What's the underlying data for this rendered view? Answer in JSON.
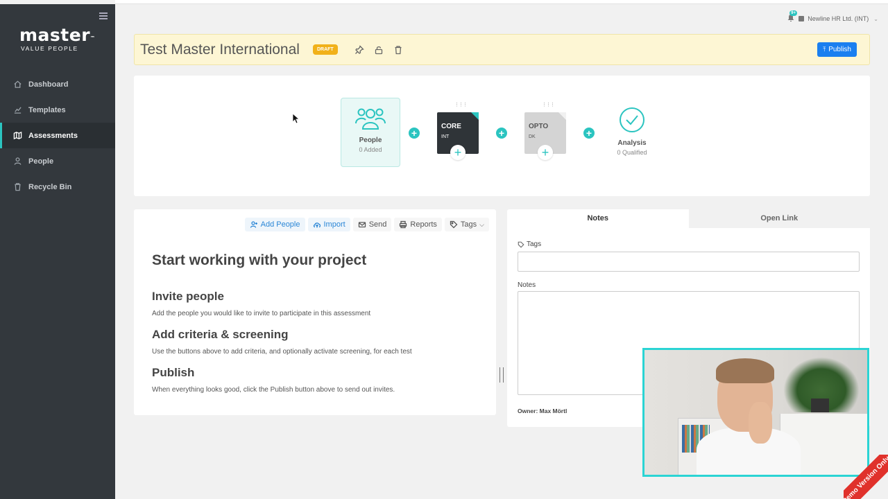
{
  "app": {
    "logo_word": "master",
    "logo_tm": "™",
    "logo_tagline": "VALUE PEOPLE",
    "accent_color": "#2bc4c0",
    "sidebar_color": "#33383d"
  },
  "sidebar": {
    "items": [
      {
        "label": "Dashboard",
        "icon": "home-icon",
        "active": false
      },
      {
        "label": "Templates",
        "icon": "chart-icon",
        "active": false
      },
      {
        "label": "Assessments",
        "icon": "map-icon",
        "active": true
      },
      {
        "label": "People",
        "icon": "person-icon",
        "active": false
      },
      {
        "label": "Recycle Bin",
        "icon": "trash-icon",
        "active": false
      }
    ]
  },
  "header": {
    "notification_badge": "9+",
    "company": "Newline HR Ltd. (INT)"
  },
  "project": {
    "title": "Test Master International",
    "status_badge": "DRAFT",
    "publish_label": "Publish",
    "publish_color": "#1a7ff0"
  },
  "pipeline": {
    "people": {
      "label": "People",
      "sub": "0 Added"
    },
    "tests": [
      {
        "name": "CORE",
        "sub": "INT"
      },
      {
        "name": "OPTO",
        "sub": "DK"
      }
    ],
    "analysis": {
      "label": "Analysis",
      "sub": "0 Qualified"
    }
  },
  "toolbar": {
    "add_people": "Add People",
    "import": "Import",
    "send": "Send",
    "reports": "Reports",
    "tags": "Tags"
  },
  "guide": {
    "heading": "Start working with your project",
    "sections": [
      {
        "title": "Invite people",
        "text": "Add the people you would like to invite to participate in this assessment"
      },
      {
        "title": "Add criteria & screening",
        "text": "Use the buttons above to add criteria, and optionally activate screening, for each test"
      },
      {
        "title": "Publish",
        "text": "When everything looks good, click the Publish button above to send out invites."
      }
    ]
  },
  "notes_panel": {
    "tabs": [
      "Notes",
      "Open Link"
    ],
    "tags_label": "Tags",
    "notes_label": "Notes",
    "owner": "Owner: Max Mörtl"
  },
  "ribbon": {
    "text": "Demo Version Only"
  }
}
